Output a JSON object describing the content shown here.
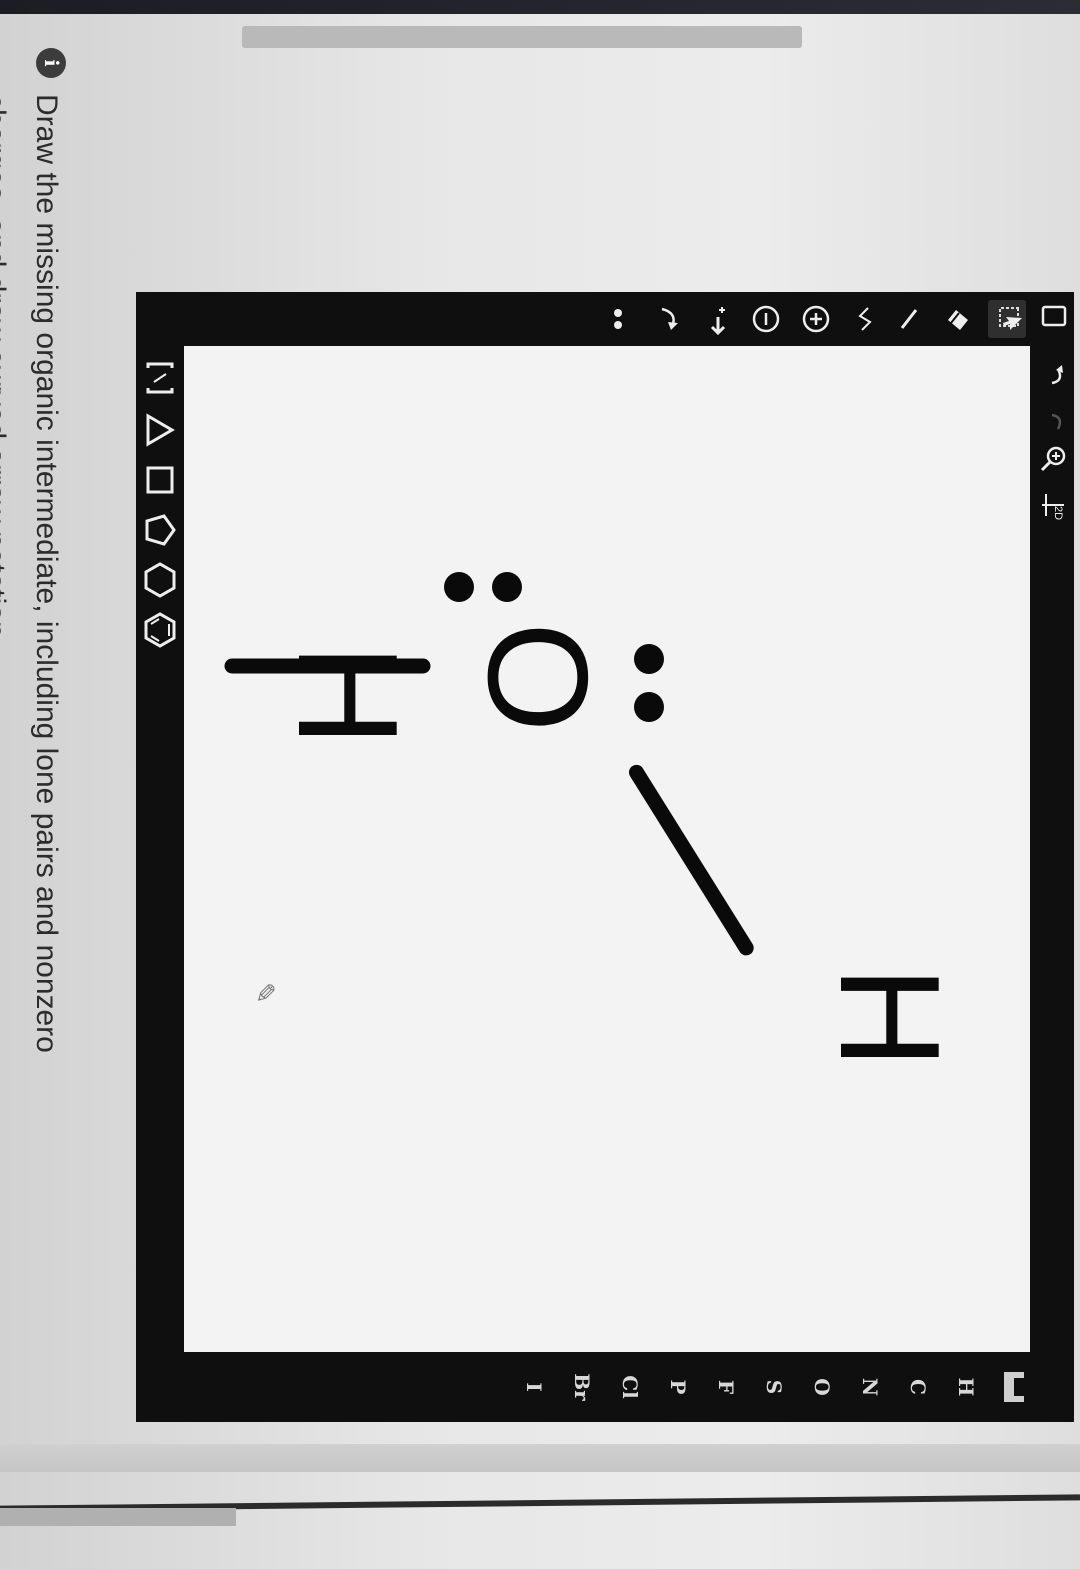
{
  "question": {
    "number_icon": "i",
    "text": "Draw the missing organic intermediate, including lone pairs and nonzero charges, and draw curved arrow notation."
  },
  "toolbar_top": {
    "items": [
      "new-icon",
      "undo-icon",
      "redo-icon",
      "zoom-icon",
      "2d-clean-icon"
    ],
    "clean_label": "2D"
  },
  "toolbar_left": {
    "items": [
      "select-icon",
      "eraser-icon",
      "single-bond-icon",
      "chain-icon",
      "plus-charge-icon",
      "minus-charge-icon",
      "reaction-arrow-icon",
      "curved-arrow-icon",
      "lone-pair-icon"
    ]
  },
  "elements": [
    "H",
    "C",
    "N",
    "O",
    "S",
    "F",
    "P",
    "Cl",
    "Br",
    "I"
  ],
  "shapes": [
    "bracket-icon",
    "triangle-icon",
    "square-icon",
    "pentagon-icon",
    "hexagon-icon",
    "benzene-icon"
  ],
  "molecule": {
    "center_atom": "O",
    "hydrogen_1": "H",
    "hydrogen_2": "H"
  },
  "colors": {
    "editor_frame": "#0f0f0f",
    "canvas": "#f3f3f3",
    "ink": "#0a0a0a"
  }
}
